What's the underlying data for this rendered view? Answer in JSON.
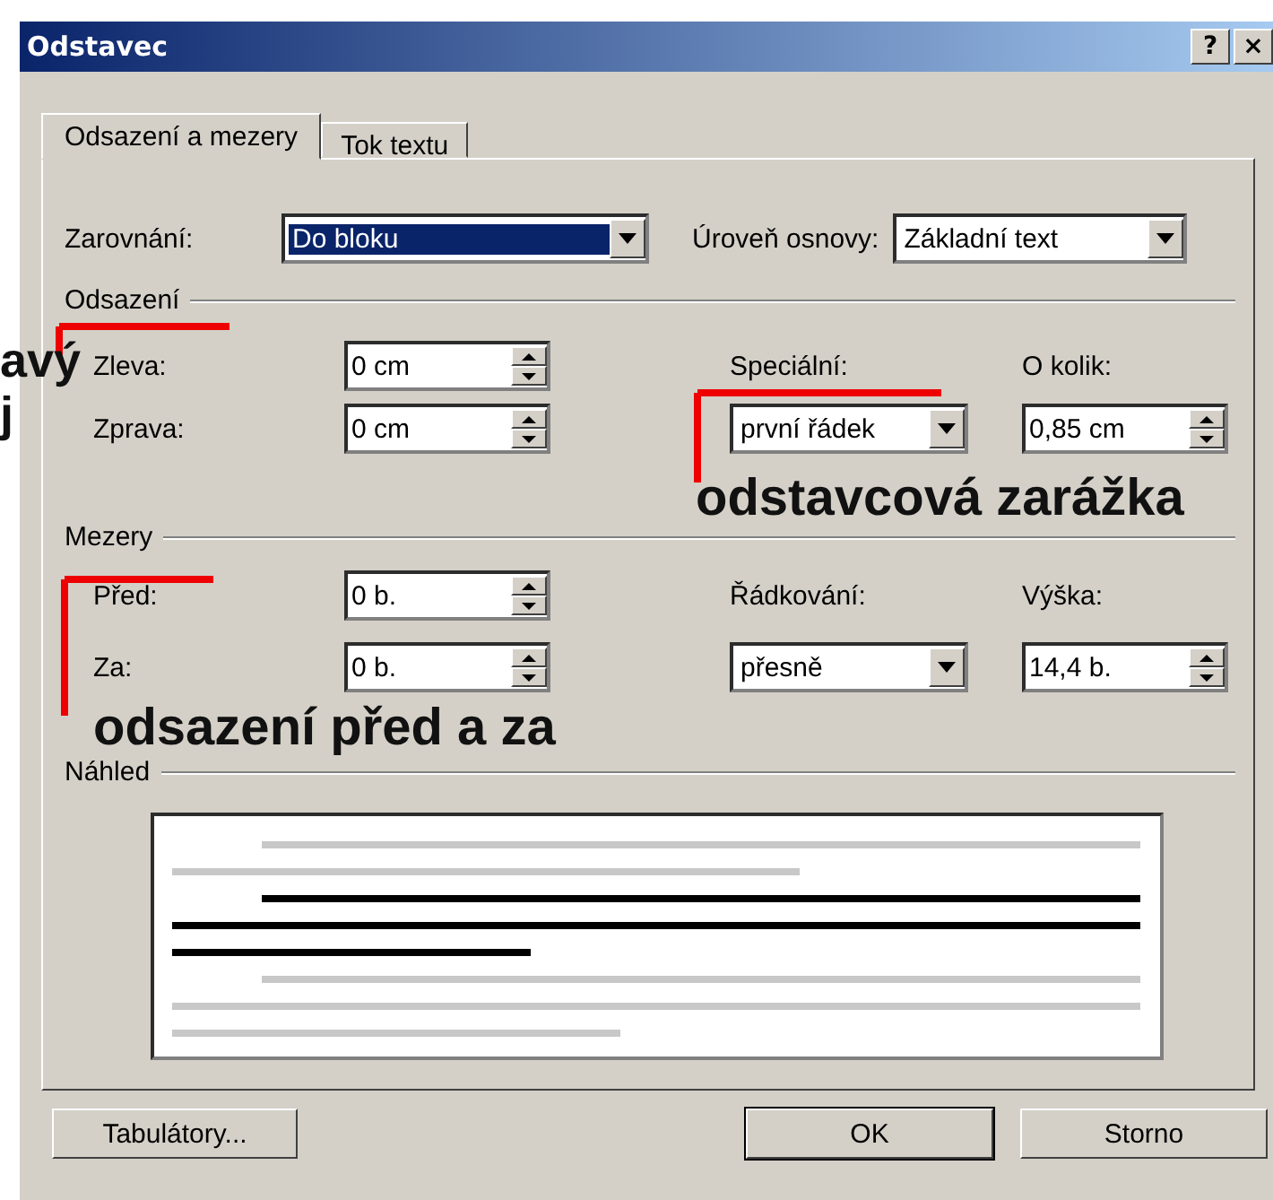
{
  "window": {
    "title": "Odstavec",
    "help_button": "?",
    "close_button": "×"
  },
  "tabs": [
    {
      "label": "Odsazení a mezery",
      "selected": true
    },
    {
      "label": "Tok textu",
      "selected": false
    }
  ],
  "general": {
    "alignment": {
      "label": "Zarovnání:",
      "value": "Do bloku",
      "focused": true
    },
    "outline_level": {
      "label": "Úroveň osnovy:",
      "value": "Základní text",
      "focused": false
    }
  },
  "indentation": {
    "title": "Odsazení",
    "left": {
      "label": "Zleva:",
      "value": "0 cm"
    },
    "right": {
      "label": "Zprava:",
      "value": "0 cm"
    },
    "special": {
      "label": "Speciální:",
      "value": "první řádek"
    },
    "by": {
      "label": "O kolik:",
      "value": "0,85 cm"
    }
  },
  "spacing": {
    "title": "Mezery",
    "before": {
      "label": "Před:",
      "value": "0 b."
    },
    "after": {
      "label": "Za:",
      "value": "0 b."
    },
    "line_spacing": {
      "label": "Řádkování:",
      "value": "přesně"
    },
    "at": {
      "label": "Výška:",
      "value": "14,4 b."
    }
  },
  "preview": {
    "title": "Náhled"
  },
  "buttons": [
    {
      "label": "Tabulátory...",
      "default": false
    },
    {
      "label": "OK",
      "default": true
    },
    {
      "label": "Storno",
      "default": false
    }
  ],
  "annotations": [
    {
      "text": "avý"
    },
    {
      "text": "j"
    },
    {
      "text": "odstavcová zarážka"
    },
    {
      "text": "odsazení před a za"
    }
  ]
}
